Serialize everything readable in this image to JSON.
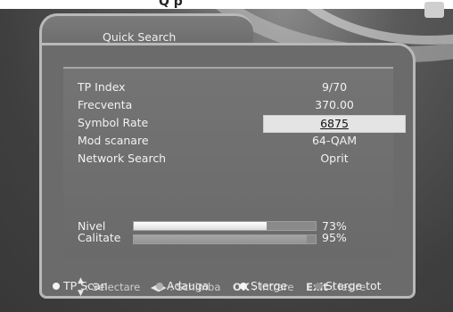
{
  "window_title": "Quick Search",
  "top_fragment": "Q    p",
  "fields": [
    {
      "label": "TP Index",
      "value": "9/70",
      "active": false
    },
    {
      "label": "Frecventa",
      "value": "370.00",
      "active": false
    },
    {
      "label": "Symbol Rate",
      "value": "6875",
      "active": true
    },
    {
      "label": "Mod scanare",
      "value": "64-QAM",
      "active": false
    },
    {
      "label": "Network Search",
      "value": "Oprit",
      "active": false
    }
  ],
  "meters": {
    "nivel": {
      "label": "Nivel",
      "value_text": "73%",
      "fraction": 0.73
    },
    "calitate": {
      "label": "Calitate",
      "value_text": "95%",
      "fraction": 0.95
    }
  },
  "help": {
    "select_label": ": Selectare",
    "change_label": ": Schimba",
    "ok_key": "OK",
    "ok_label": ": Intrare",
    "exit_key": "Exit",
    "exit_label": ": Iesire"
  },
  "footer": {
    "tp_scan": "TP Scan",
    "adauga": "Adauga",
    "sterge": "Sterge",
    "sterge_tot": "Sterge tot"
  }
}
